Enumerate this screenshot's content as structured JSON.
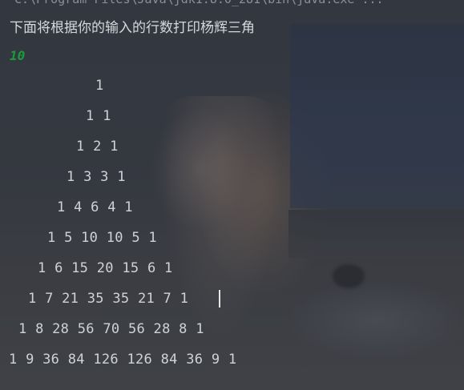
{
  "console": {
    "path_line": "C:\\Program Files\\Java\\jdk1.8.0_281\\bin\\java.exe ...",
    "prompt_text": "下面将根据你的输入的行数打印杨辉三角",
    "input_value": "10",
    "rows": [
      "1",
      "1 1",
      "1 2 1",
      "1 3 3 1",
      "1 4 6 4 1",
      "1 5 10 10 5 1",
      "1 6 15 20 15 6 1",
      "1 7 21 35 35 21 7 1",
      "1 8 28 56 70 56 28 8 1",
      "1 9 36 84 126 126 84 36 9 1"
    ]
  },
  "colors": {
    "input_echo": "#1f9a3a",
    "text": "#cfd2d7"
  }
}
